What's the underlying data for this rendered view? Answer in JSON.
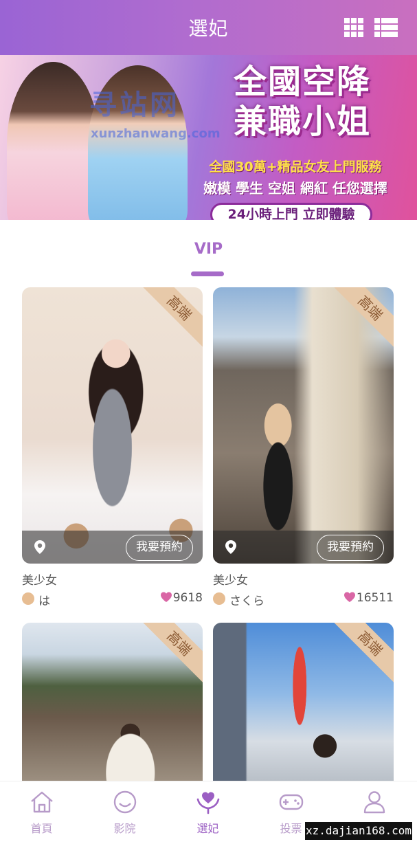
{
  "header": {
    "title": "選妃",
    "grid_view_icon": "grid-icon",
    "list_view_icon": "list-icon"
  },
  "banner": {
    "headline_line1": "全國空降",
    "headline_line2": "兼職小姐",
    "subtitle": "全國30萬+精品女友上門服務",
    "subtitle2": "嫩模 學生 空姐 網紅 任您選擇",
    "pill": "24小時上門 立即體驗",
    "watermark": "寻站网",
    "watermark_url": "xunzhanwang.com"
  },
  "section": {
    "title": "VIP"
  },
  "cards": [
    {
      "ribbon": "高端",
      "book_label": "我要預約",
      "name": "美少女",
      "user": "は",
      "likes": "9618"
    },
    {
      "ribbon": "高端",
      "book_label": "我要預約",
      "name": "美少女",
      "user": "さくら",
      "likes": "16511"
    },
    {
      "ribbon": "高端"
    },
    {
      "ribbon": "高端"
    }
  ],
  "nav": [
    {
      "label": "首頁",
      "icon": "home-icon"
    },
    {
      "label": "影院",
      "icon": "smile-icon"
    },
    {
      "label": "選妃",
      "icon": "heart-hands-icon",
      "active": true
    },
    {
      "label": "投票",
      "icon": "gamepad-icon"
    },
    {
      "label": "個人",
      "icon": "user-icon"
    }
  ],
  "footer_stamp": "xz.dajian168.com",
  "colors": {
    "accent": "#9b5fc3",
    "ribbon": "#e7c9a9",
    "heart": "#d966a5"
  }
}
